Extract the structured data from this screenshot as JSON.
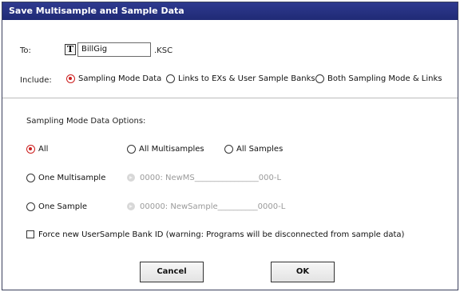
{
  "dialog": {
    "title": "Save Multisample and Sample Data",
    "to_label": "To:",
    "filename": "BillGig",
    "extension": ".KSC",
    "include_label": "Include:",
    "include_options": [
      {
        "label": "Sampling Mode Data",
        "selected": true
      },
      {
        "label": "Links to EXs & User Sample Banks",
        "selected": false
      },
      {
        "label": "Both Sampling Mode & Links",
        "selected": false
      }
    ],
    "options_heading": "Sampling Mode Data Options:",
    "scope_options": [
      {
        "label": "All",
        "selected": true
      },
      {
        "label": "All Multisamples",
        "selected": false
      },
      {
        "label": "All Samples",
        "selected": false
      }
    ],
    "one_multisample_label": "One Multisample",
    "one_multisample_value": "0000: NewMS________________000-L",
    "one_sample_label": "One Sample",
    "one_sample_value": "00000: NewSample__________0000-L",
    "force_bank_label": "Force new UserSample Bank ID (warning: Programs will be disconnected from sample data)",
    "cancel_label": "Cancel",
    "ok_label": "OK",
    "colors": {
      "title_bar": "#1f2a75",
      "radio_selected": "#cc1f1f"
    }
  }
}
